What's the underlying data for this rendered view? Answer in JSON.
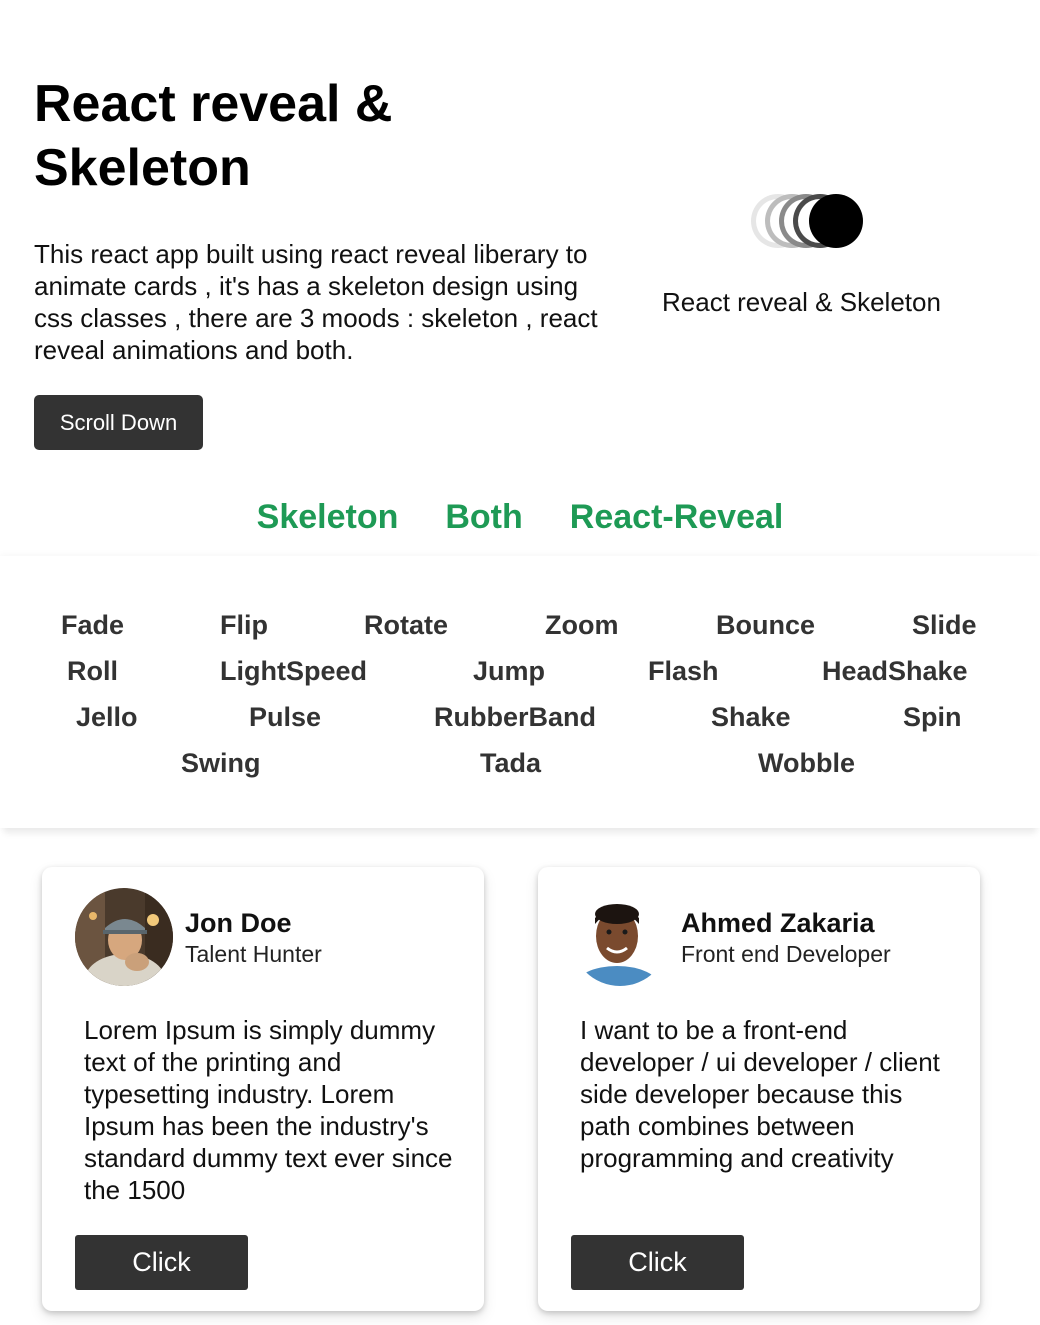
{
  "hero": {
    "title": "React reveal & Skeleton",
    "description": "This react app built using react reveal liberary to animate cards , it's has a skeleton design using css classes , there are 3 moods : skeleton , react reveal animations and both.",
    "button_label": "Scroll Down",
    "logo_caption": "React reveal & Skeleton",
    "logo_icon": "stacked-circles-icon"
  },
  "modes": [
    "Skeleton",
    "Both",
    "React-Reveal"
  ],
  "colors": {
    "accent_green": "#1e9a55",
    "button_dark": "#333333",
    "text": "#111111"
  },
  "animations": [
    "Fade",
    "Flip",
    "Rotate",
    "Zoom",
    "Bounce",
    "Slide",
    "Roll",
    "LightSpeed",
    "Jump",
    "Flash",
    "HeadShake",
    "Jello",
    "Pulse",
    "RubberBand",
    "Shake",
    "Spin",
    "Swing",
    "Tada",
    "Wobble"
  ],
  "cards": [
    {
      "name": "Jon Doe",
      "role": "Talent Hunter",
      "text": "Lorem Ipsum is simply dummy text of the printing and typesetting industry. Lorem Ipsum has been the industry's standard dummy text ever since the 1500",
      "button_label": "Click"
    },
    {
      "name": "Ahmed Zakaria",
      "role": "Front end Developer",
      "text": "I want to be a front-end developer / ui developer / client side developer because this path combines between programming and creativity",
      "button_label": "Click"
    }
  ]
}
